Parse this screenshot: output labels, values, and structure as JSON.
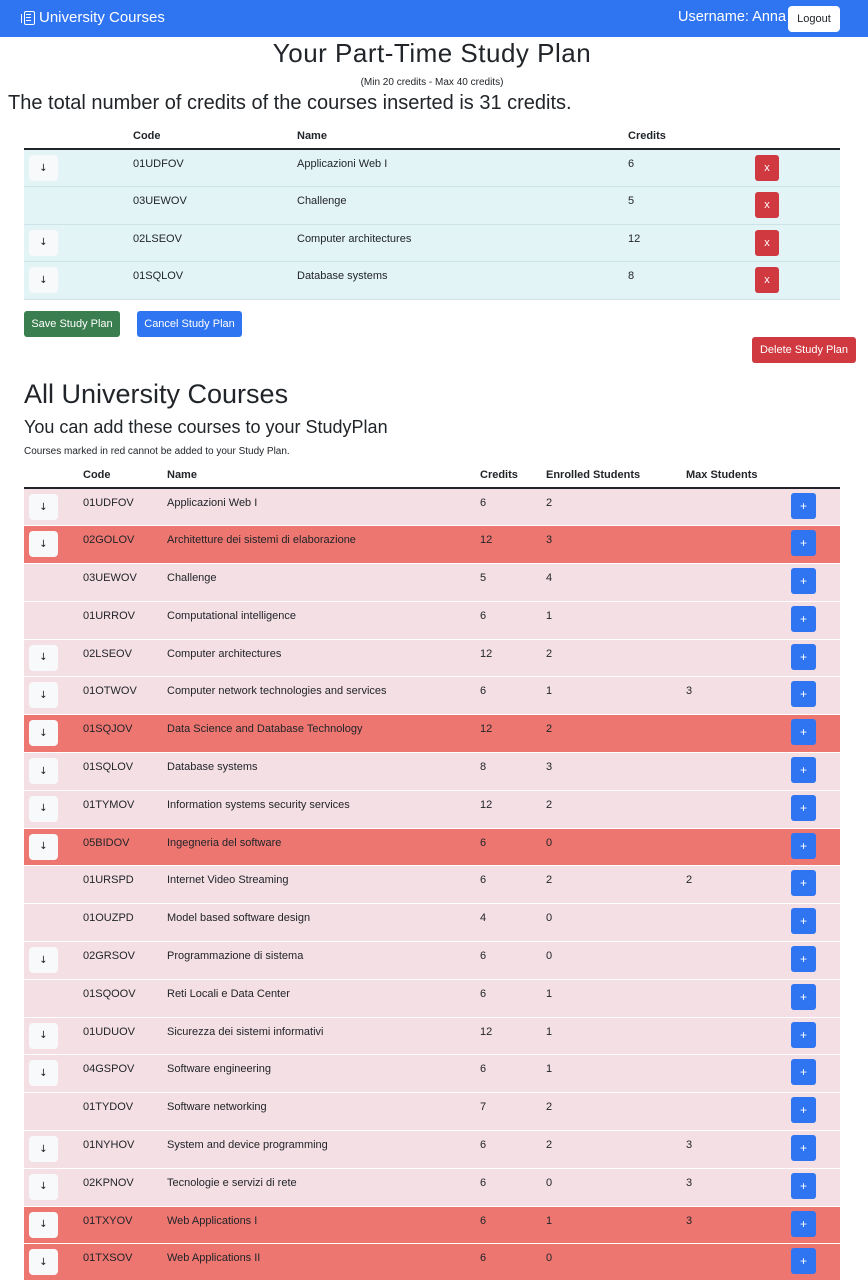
{
  "navbar": {
    "brand": "University Courses",
    "username": "Username: Anna",
    "logout": "Logout"
  },
  "plan": {
    "title": "Your Part-Time Study Plan",
    "subtitle": "(Min 20 credits - Max 40 credits)",
    "total": "The total number of credits of the courses inserted is 31 credits.",
    "headers": {
      "code": "Code",
      "name": "Name",
      "credits": "Credits"
    },
    "rows": [
      {
        "code": "01UDFOV",
        "name": "Applicazioni Web I",
        "credits": "6",
        "has_arrow": true
      },
      {
        "code": "03UEWOV",
        "name": "Challenge",
        "credits": "5",
        "has_arrow": false
      },
      {
        "code": "02LSEOV",
        "name": "Computer architectures",
        "credits": "12",
        "has_arrow": true
      },
      {
        "code": "01SQLOV",
        "name": "Database systems",
        "credits": "8",
        "has_arrow": true
      }
    ],
    "remove_label": "x",
    "arrow_label": "↓",
    "save": "Save Study Plan",
    "cancel": "Cancel Study Plan",
    "delete": "Delete Study Plan"
  },
  "courses": {
    "title": "All University Courses",
    "subtitle": "You can add these courses to your StudyPlan",
    "note": "Courses marked in red cannot be added to your Study Plan.",
    "headers": {
      "code": "Code",
      "name": "Name",
      "credits": "Credits",
      "enrolled": "Enrolled Students",
      "max": "Max Students"
    },
    "add_label": "+",
    "arrow_label": "↓",
    "colors": {
      "normal_row": "#f4dfe4",
      "blocked_row": "#ee7671",
      "primary": "#2f74f0",
      "danger": "#d0393f",
      "success": "#3a7d4e"
    },
    "rows": [
      {
        "code": "01UDFOV",
        "name": "Applicazioni Web I",
        "credits": "6",
        "enrolled": "2",
        "max": "",
        "has_arrow": true,
        "blocked": false
      },
      {
        "code": "02GOLOV",
        "name": "Architetture dei sistemi di elaborazione",
        "credits": "12",
        "enrolled": "3",
        "max": "",
        "has_arrow": true,
        "blocked": true
      },
      {
        "code": "03UEWOV",
        "name": "Challenge",
        "credits": "5",
        "enrolled": "4",
        "max": "",
        "has_arrow": false,
        "blocked": false
      },
      {
        "code": "01URROV",
        "name": "Computational intelligence",
        "credits": "6",
        "enrolled": "1",
        "max": "",
        "has_arrow": false,
        "blocked": false
      },
      {
        "code": "02LSEOV",
        "name": "Computer architectures",
        "credits": "12",
        "enrolled": "2",
        "max": "",
        "has_arrow": true,
        "blocked": false
      },
      {
        "code": "01OTWOV",
        "name": "Computer network technologies and services",
        "credits": "6",
        "enrolled": "1",
        "max": "3",
        "has_arrow": true,
        "blocked": false
      },
      {
        "code": "01SQJOV",
        "name": "Data Science and Database Technology",
        "credits": "12",
        "enrolled": "2",
        "max": "",
        "has_arrow": true,
        "blocked": true
      },
      {
        "code": "01SQLOV",
        "name": "Database systems",
        "credits": "8",
        "enrolled": "3",
        "max": "",
        "has_arrow": true,
        "blocked": false
      },
      {
        "code": "01TYMOV",
        "name": "Information systems security services",
        "credits": "12",
        "enrolled": "2",
        "max": "",
        "has_arrow": true,
        "blocked": false
      },
      {
        "code": "05BIDOV",
        "name": "Ingegneria del software",
        "credits": "6",
        "enrolled": "0",
        "max": "",
        "has_arrow": true,
        "blocked": true
      },
      {
        "code": "01URSPD",
        "name": "Internet Video Streaming",
        "credits": "6",
        "enrolled": "2",
        "max": "2",
        "has_arrow": false,
        "blocked": false
      },
      {
        "code": "01OUZPD",
        "name": "Model based software design",
        "credits": "4",
        "enrolled": "0",
        "max": "",
        "has_arrow": false,
        "blocked": false
      },
      {
        "code": "02GRSOV",
        "name": "Programmazione di sistema",
        "credits": "6",
        "enrolled": "0",
        "max": "",
        "has_arrow": true,
        "blocked": false
      },
      {
        "code": "01SQOOV",
        "name": "Reti Locali e Data Center",
        "credits": "6",
        "enrolled": "1",
        "max": "",
        "has_arrow": false,
        "blocked": false
      },
      {
        "code": "01UDUOV",
        "name": "Sicurezza dei sistemi informativi",
        "credits": "12",
        "enrolled": "1",
        "max": "",
        "has_arrow": true,
        "blocked": false
      },
      {
        "code": "04GSPOV",
        "name": "Software engineering",
        "credits": "6",
        "enrolled": "1",
        "max": "",
        "has_arrow": true,
        "blocked": false
      },
      {
        "code": "01TYDOV",
        "name": "Software networking",
        "credits": "7",
        "enrolled": "2",
        "max": "",
        "has_arrow": false,
        "blocked": false
      },
      {
        "code": "01NYHOV",
        "name": "System and device programming",
        "credits": "6",
        "enrolled": "2",
        "max": "3",
        "has_arrow": true,
        "blocked": false
      },
      {
        "code": "02KPNOV",
        "name": "Tecnologie e servizi di rete",
        "credits": "6",
        "enrolled": "0",
        "max": "3",
        "has_arrow": true,
        "blocked": false
      },
      {
        "code": "01TXYOV",
        "name": "Web Applications I",
        "credits": "6",
        "enrolled": "1",
        "max": "3",
        "has_arrow": true,
        "blocked": true
      },
      {
        "code": "01TXSOV",
        "name": "Web Applications II",
        "credits": "6",
        "enrolled": "0",
        "max": "",
        "has_arrow": true,
        "blocked": true
      }
    ]
  }
}
